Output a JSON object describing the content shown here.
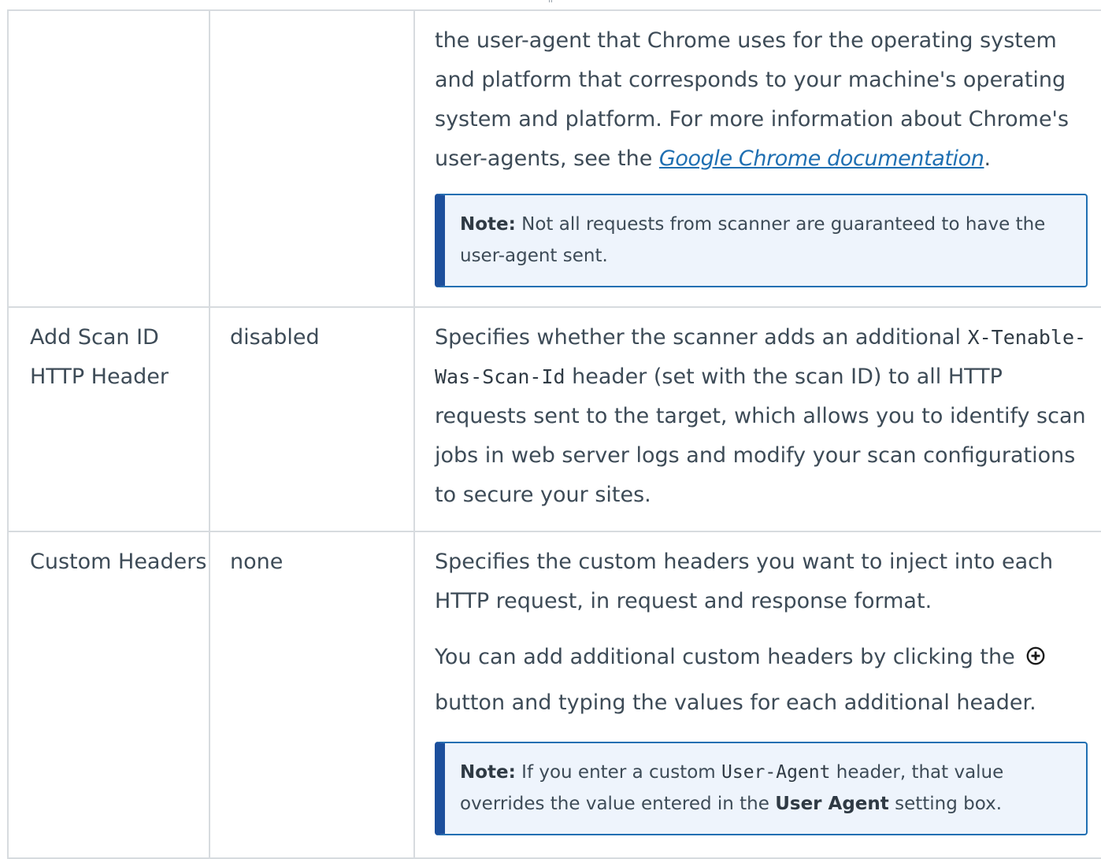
{
  "rows": [
    {
      "name": "",
      "default": "",
      "desc_lead": "the user-agent that Chrome uses for the operating system and platform that corresponds to your machine's operating system and platform. For more information about Chrome's user-agents, see the ",
      "link": "Google Chrome documentation",
      "desc_tail": ".",
      "note_label": "Note:",
      "note_text": " Not all requests from scanner are guaranteed to have the user-agent sent."
    },
    {
      "name": "Add Scan ID HTTP Header",
      "default": "disabled",
      "desc_a": "Specifies whether the scanner adds an additional ",
      "code": "X-Tenable-Was-Scan-Id",
      "desc_b": " header (set with the scan ID) to all HTTP requests sent to the target, which allows you to identify scan jobs in web server logs and modify your scan configurations to secure your sites."
    },
    {
      "name": "Custom Headers",
      "default": "none",
      "desc": "Specifies the custom headers you want to inject into each HTTP request, in request and response format.",
      "desc2_a": "You can add additional custom headers by clicking the ",
      "desc2_b": " button and typing the values for each additional header.",
      "note_label": "Note:",
      "note_a": " If you enter a custom ",
      "note_code": "User-Agent",
      "note_b": " header, that value overrides the value entered in the ",
      "note_strong": "User Agent",
      "note_c": " setting box."
    }
  ],
  "colors": {
    "text": "#3d4b57",
    "link": "#1f6fb2",
    "note_bg": "#eef4fc",
    "note_border": "#1c4f9c",
    "grid": "#d7dbdf"
  }
}
